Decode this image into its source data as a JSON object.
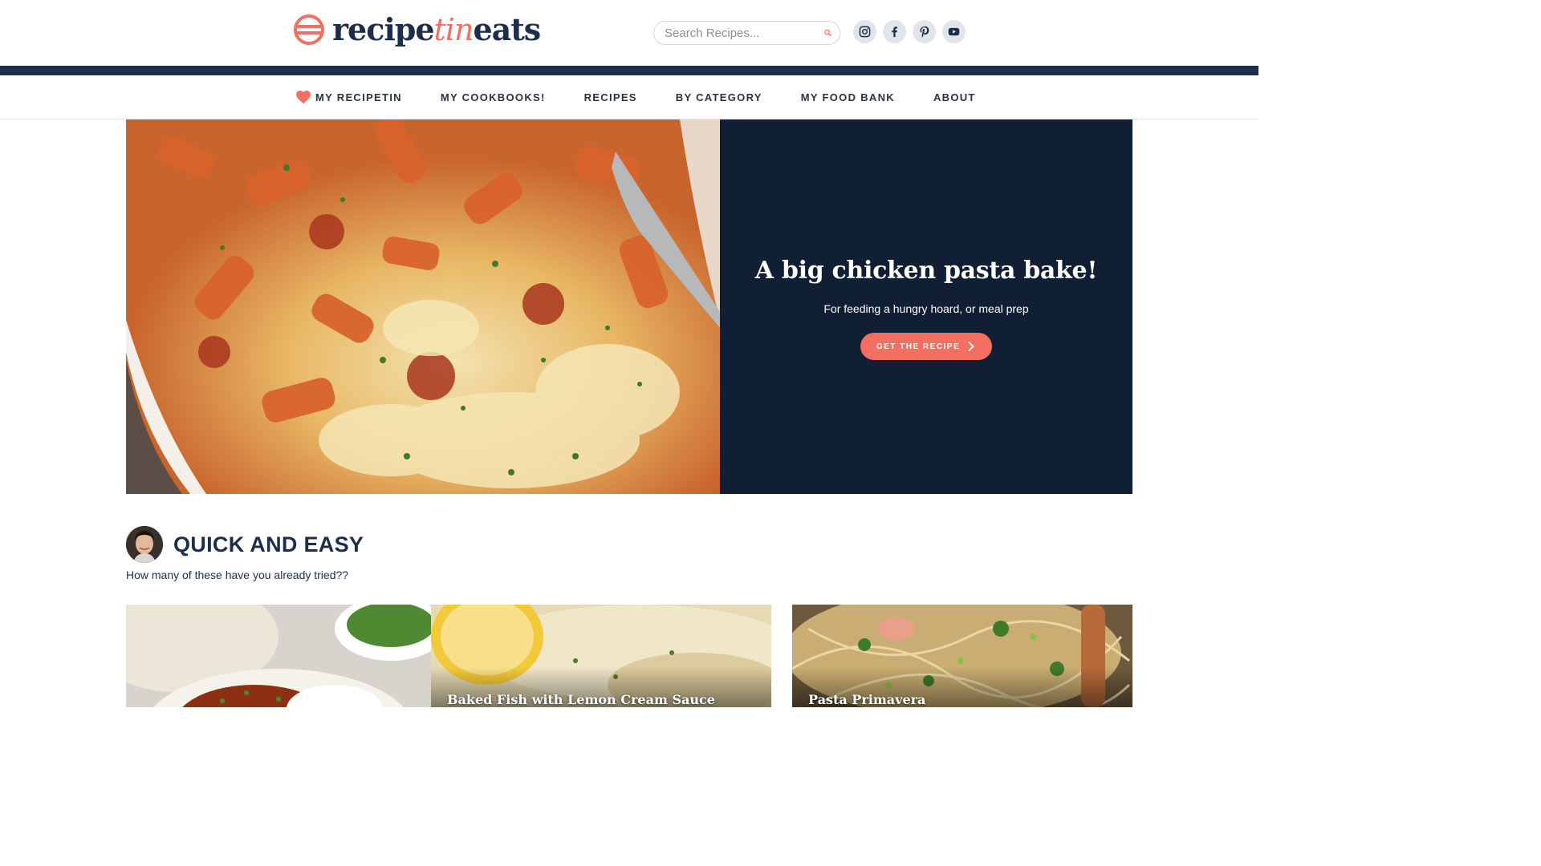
{
  "header": {
    "logo": {
      "part1": "recipe",
      "part2": "tin",
      "part3": "eats"
    },
    "search": {
      "placeholder": "Search Recipes..."
    },
    "socials": [
      "instagram-icon",
      "facebook-icon",
      "pinterest-icon",
      "youtube-icon"
    ]
  },
  "nav": {
    "items": [
      {
        "label": "MY RECIPETIN"
      },
      {
        "label": "MY COOKBOOKS!"
      },
      {
        "label": "RECIPES"
      },
      {
        "label": "BY CATEGORY"
      },
      {
        "label": "MY FOOD BANK"
      },
      {
        "label": "ABOUT"
      }
    ]
  },
  "hero": {
    "title": "A big chicken pasta bake!",
    "subtitle": "For feeding a hungry hoard, or meal prep",
    "button": "GET THE RECIPE"
  },
  "section": {
    "title": "QUICK AND EASY",
    "subtitle": "How many of these have you already tried??"
  },
  "cards": [
    {
      "title": ""
    },
    {
      "title": "Baked Fish with Lemon Cream Sauce"
    },
    {
      "title": "Pasta Primavera"
    }
  ],
  "colors": {
    "brand_navy": "#1c2e4a",
    "accent_coral": "#f26f62",
    "hero_panel": "#101f33"
  }
}
